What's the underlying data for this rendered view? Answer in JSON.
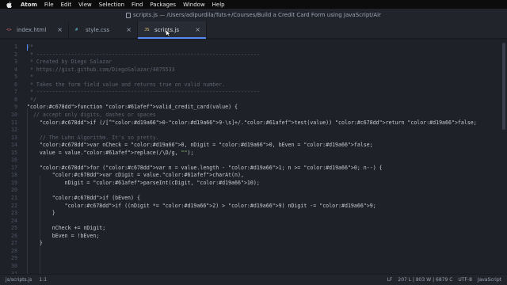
{
  "menubar": {
    "app_name": "Atom",
    "items": [
      "File",
      "Edit",
      "View",
      "Selection",
      "Find",
      "Packages",
      "Window",
      "Help"
    ]
  },
  "window": {
    "title": "scripts.js — /Users/adipurdila/Tuts+/Courses/Build a Credit Card Form using JavaScript/Air"
  },
  "tabs": [
    {
      "label": "index.html",
      "icon": "<>"
    },
    {
      "label": "style.css",
      "icon": "#"
    },
    {
      "label": "scripts.js",
      "icon": "JS"
    }
  ],
  "editor": {
    "line_numbers": [
      "1",
      "2",
      "3",
      "4",
      "5",
      "6",
      "7",
      "8",
      "9",
      "10",
      "11",
      "12",
      "13",
      "14",
      "15",
      "16",
      "17",
      "18",
      "19",
      "20",
      "21",
      "22",
      "23",
      "24",
      "25",
      "26",
      "27",
      "28",
      "29",
      "30",
      "31"
    ],
    "lines": [
      "/*",
      " * -----------------------------------------------------------------------",
      " * Created by Diego Salazar",
      " * https://gist.github.com/DiegoSalazar/4075533",
      " *",
      " * Takes the form field value and returns true on valid number.",
      " * -----------------------------------------------------------------------",
      " */",
      "function valid_credit_card(value) {",
      "  // accept only digits, dashes or spaces",
      "    if (/[^0-9-\\s]+/.test(value)) return false;",
      "",
      "    // The Luhn Algorithm. It's so pretty.",
      "    var nCheck = 0, nDigit = 0, bEven = false;",
      "    value = value.replace(/\\D/g, \"\");",
      "",
      "    for (var n = value.length - 1; n >= 0; n--) {",
      "        var cDigit = value.charAt(n),",
      "            nDigit = parseInt(cDigit, 10);",
      "",
      "        if (bEven) {",
      "            if ((nDigit *= 2) > 9) nDigit -= 9;",
      "        }",
      "",
      "        nCheck += nDigit;",
      "        bEven = !bEven;",
      "    }",
      "",
      "",
      "",
      ""
    ]
  },
  "statusbar": {
    "file_path": "js/scripts.js",
    "cursor_position": "1:1",
    "line_ending": "LF",
    "selection_info": "207 L | 803 W | 6879 C",
    "encoding": "UTF-8",
    "grammar": "JavaScript"
  },
  "colors": {
    "accent": "#568af2",
    "editor_background": "#1e2127",
    "chrome_background": "#21252b",
    "comment": "#5c6370",
    "keyword": "#c678dd",
    "function": "#61afef",
    "string": "#98c379",
    "number": "#d19a66"
  }
}
